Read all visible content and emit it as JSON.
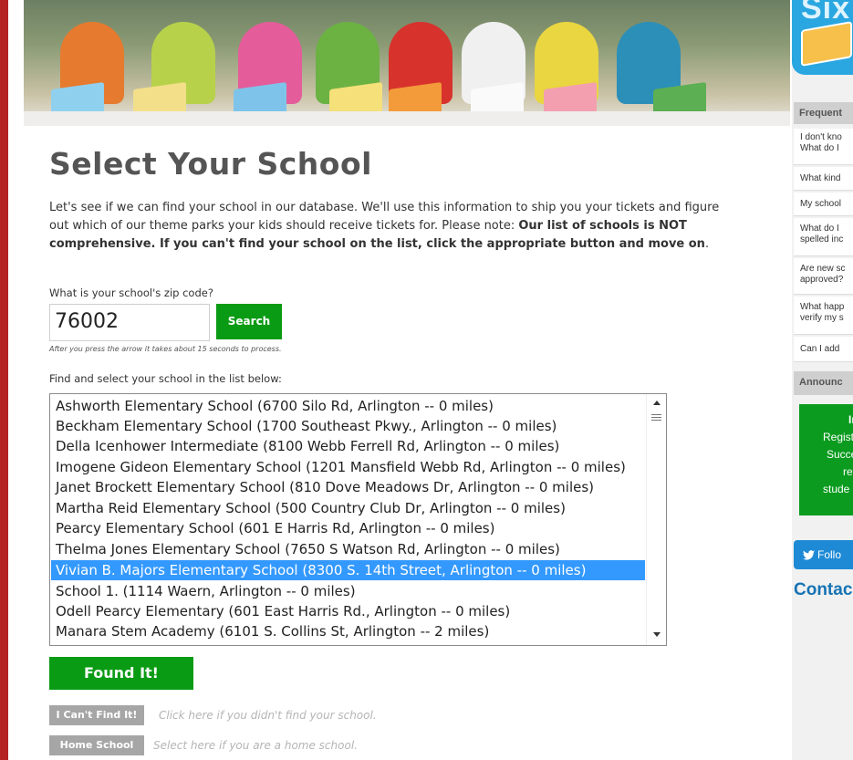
{
  "page": {
    "title": "Select Your School",
    "intro_plain": "Let's see if we can find your school in our database. We'll use this information to ship you your tickets and figure out which of our theme parks your kids should receive tickets for. Please note: ",
    "intro_bold": "Our list of schools is NOT comprehensive. If you can't find your school on the list, click the appropriate button and move on",
    "intro_end": "."
  },
  "zip": {
    "label": "What is your school's zip code?",
    "value": "76002",
    "search_label": "Search",
    "hint": "After you press the arrow it takes about 15 seconds to process."
  },
  "school_list": {
    "label": "Find and select your school in the list below:",
    "selected_index": 8,
    "items": [
      "Ashworth Elementary School (6700 Silo Rd, Arlington -- 0 miles)",
      "Beckham Elementary School (1700 Southeast Pkwy., Arlington -- 0 miles)",
      "Della Icenhower Intermediate (8100 Webb Ferrell Rd, Arlington -- 0 miles)",
      "Imogene Gideon Elementary School (1201 Mansfield Webb Rd, Arlington -- 0 miles)",
      "Janet Brockett Elementary School (810 Dove Meadows Dr, Arlington -- 0 miles)",
      "Martha Reid Elementary School (500 Country Club Dr, Arlington -- 0 miles)",
      "Pearcy Elementary School (601 E Harris Rd, Arlington -- 0 miles)",
      "Thelma Jones Elementary School (7650 S Watson Rd, Arlington -- 0 miles)",
      "Vivian B. Majors Elementary School (8300 S. 14th Street, Arlington -- 0 miles)",
      "School 1. (1114 Waern, Arlington -- 0 miles)",
      "Odell Pearcy Elementary (601 East Harris Rd., Arlington -- 0 miles)",
      "Manara Stem Academy (6101 S. Collins St, Arlington -- 2 miles)"
    ]
  },
  "actions": {
    "found_label": "Found It!",
    "cant_find_label": "I Can't Find It!",
    "cant_find_hint": "Click here if you didn't find your school.",
    "home_school_label": "Home School",
    "home_school_hint": "Select here if you are a home school."
  },
  "sidebar": {
    "faq_heading": "Frequent",
    "faq_items": [
      {
        "line1": "I don't kno",
        "line2": "What do I"
      },
      {
        "line1": "What kind",
        "line2": ""
      },
      {
        "line1": "My school",
        "line2": ""
      },
      {
        "line1": "What do I",
        "line2": "spelled inc"
      },
      {
        "line1": "Are new sc",
        "line2": "approved?"
      },
      {
        "line1": "What happ",
        "line2": "verify my s"
      },
      {
        "line1": "Can I add",
        "line2": ""
      }
    ],
    "announce_heading": "Announc",
    "announce_lines": [
      "In",
      "Regist",
      "Succe",
      "reg",
      "stude"
    ],
    "follow_label": "Follo",
    "contact_label": "Contac",
    "brand_text": "Six"
  },
  "colors": {
    "accent_green": "#0a9b14",
    "selected_blue": "#3399ff",
    "left_bar_red": "#b52222",
    "twitter_blue": "#1e8ad6",
    "contact_blue": "#1673b4"
  }
}
